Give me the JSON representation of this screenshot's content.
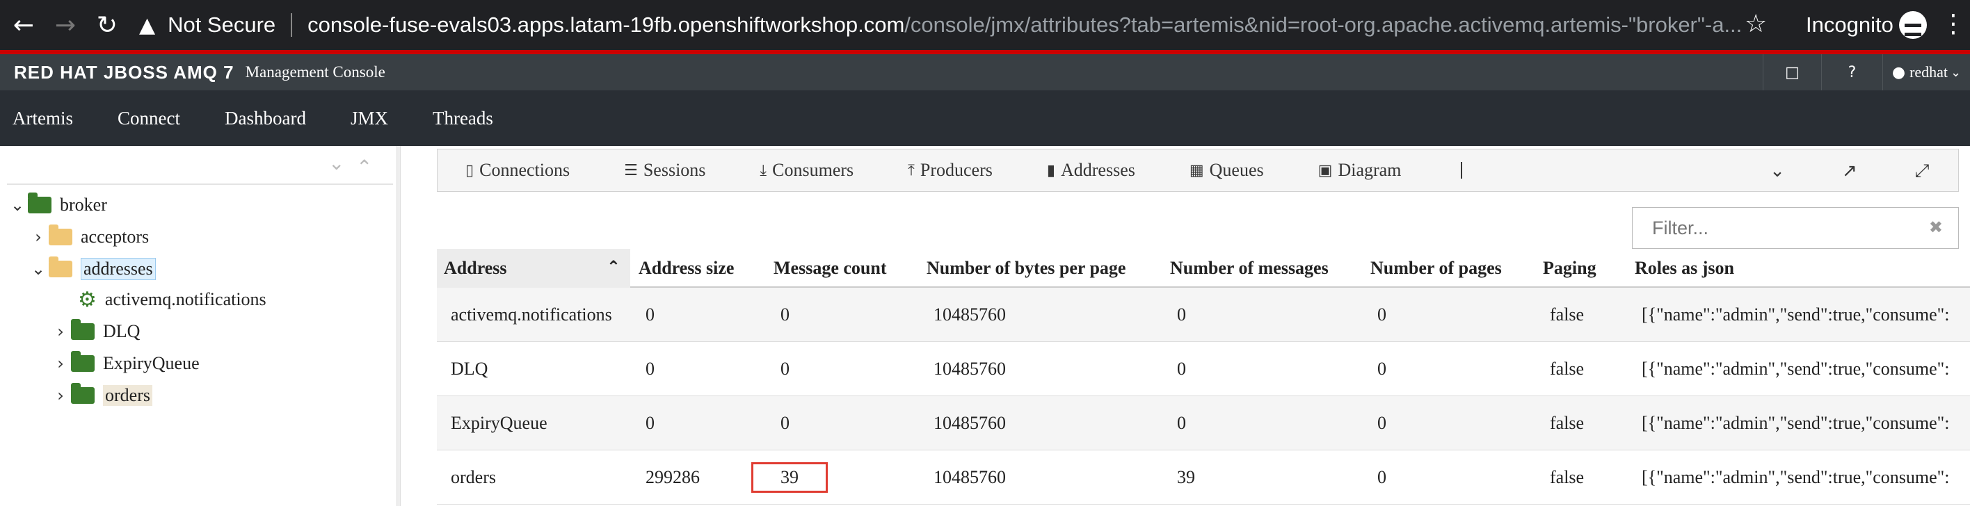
{
  "browser": {
    "back_icon": "arrow-left-icon",
    "forward_icon": "arrow-right-icon",
    "reload_icon": "reload-icon",
    "security_label": "Not Secure",
    "url_host": "console-fuse-evals03.apps.latam-19fb.openshiftworkshop.com",
    "url_path": "/console/jmx/attributes?tab=artemis&nid=root-org.apache.activemq.artemis-\"broker\"-a...",
    "profile_label": "Incognito"
  },
  "app": {
    "brand": "RED HAT JBOSS AMQ 7",
    "brand_sub": "Management Console",
    "user": "redhat",
    "accent_color": "#cc0000"
  },
  "nav": {
    "items": [
      "Artemis",
      "Connect",
      "Dashboard",
      "JMX",
      "Threads"
    ]
  },
  "tree": {
    "root": "broker",
    "acceptors": "acceptors",
    "addresses": "addresses",
    "notifications": "activemq.notifications",
    "dlq": "DLQ",
    "expiry": "ExpiryQueue",
    "orders": "orders"
  },
  "tabs": {
    "connections": "Connections",
    "sessions": "Sessions",
    "consumers": "Consumers",
    "producers": "Producers",
    "addresses": "Addresses",
    "queues": "Queues",
    "diagram": "Diagram"
  },
  "filter": {
    "placeholder": "Filter..."
  },
  "table": {
    "headers": [
      "Address",
      "Address size",
      "Message count",
      "Number of bytes per page",
      "Number of messages",
      "Number of pages",
      "Paging",
      "Roles as json"
    ],
    "rows": [
      [
        "activemq.notifications",
        "0",
        "0",
        "10485760",
        "0",
        "0",
        "false",
        "[{\"name\":\"admin\",\"send\":true,\"consume\":"
      ],
      [
        "DLQ",
        "0",
        "0",
        "10485760",
        "0",
        "0",
        "false",
        "[{\"name\":\"admin\",\"send\":true,\"consume\":"
      ],
      [
        "ExpiryQueue",
        "0",
        "0",
        "10485760",
        "0",
        "0",
        "false",
        "[{\"name\":\"admin\",\"send\":true,\"consume\":"
      ],
      [
        "orders",
        "299286",
        "39",
        "10485760",
        "39",
        "0",
        "false",
        "[{\"name\":\"admin\",\"send\":true,\"consume\":"
      ]
    ]
  }
}
